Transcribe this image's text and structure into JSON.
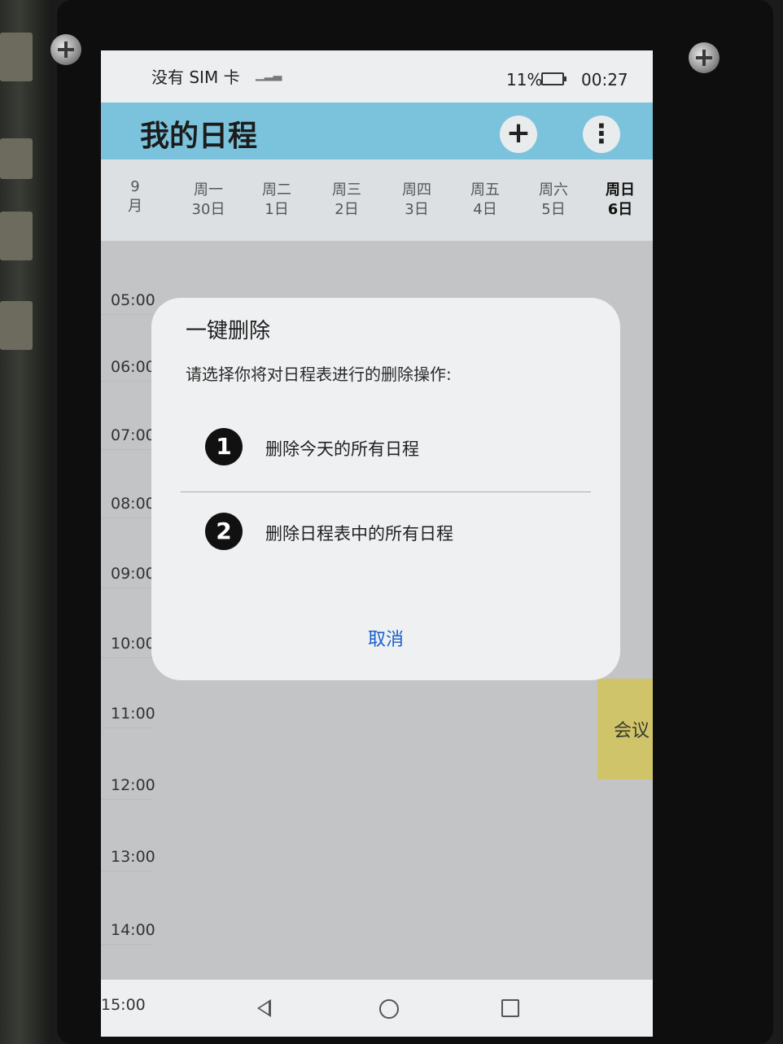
{
  "status_bar": {
    "carrier": "没有 SIM 卡",
    "battery": "11%",
    "time": "00:27"
  },
  "app_bar": {
    "title": "我的日程",
    "add_icon": "plus-icon",
    "more_icon": "more-vertical-icon",
    "add_glyph": "+",
    "more_glyph": "⋮"
  },
  "week": {
    "month_number": "9",
    "month_unit": "月",
    "days": [
      {
        "weekday": "周一",
        "date": "30日",
        "today": false
      },
      {
        "weekday": "周二",
        "date": "1日",
        "today": false
      },
      {
        "weekday": "周三",
        "date": "2日",
        "today": false
      },
      {
        "weekday": "周四",
        "date": "3日",
        "today": false
      },
      {
        "weekday": "周五",
        "date": "4日",
        "today": false
      },
      {
        "weekday": "周六",
        "date": "5日",
        "today": false
      },
      {
        "weekday": "周日",
        "date": "6日",
        "today": true
      }
    ]
  },
  "timeline": {
    "hours": [
      "05:00",
      "06:00",
      "07:00",
      "08:00",
      "09:00",
      "10:00",
      "11:00",
      "12:00",
      "13:00",
      "14:00"
    ],
    "last_hour": "15:00"
  },
  "event": {
    "title": "会议",
    "color": "#cfc46a"
  },
  "dialog": {
    "title": "一键删除",
    "message": "请选择你将对日程表进行的删除操作:",
    "options": [
      {
        "number": "1",
        "label": "删除今天的所有日程"
      },
      {
        "number": "2",
        "label": "删除日程表中的所有日程"
      }
    ],
    "cancel_label": "取消",
    "cancel_color": "#1a5fd0"
  },
  "colors": {
    "app_bar": "#7bc3dd"
  }
}
